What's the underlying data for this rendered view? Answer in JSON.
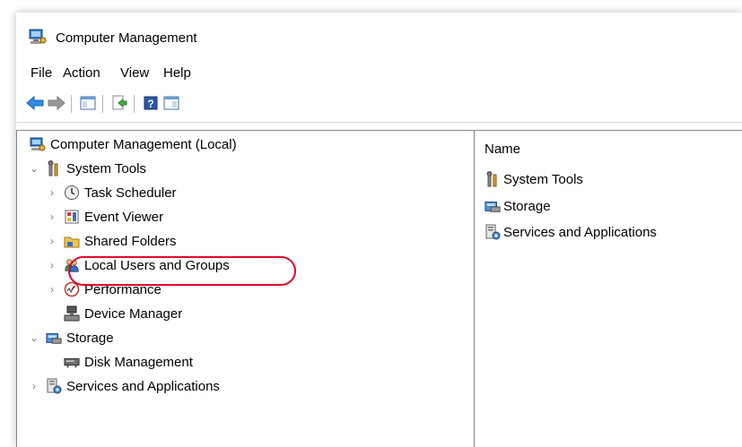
{
  "window": {
    "title": "Computer Management"
  },
  "menu": [
    "File",
    "Action",
    "View",
    "Help"
  ],
  "toolbar": [
    {
      "icon": "back-arrow-icon"
    },
    {
      "icon": "forward-arrow-icon"
    },
    {
      "icon": "show-hide-console-tree-icon"
    },
    {
      "icon": "export-list-icon"
    },
    {
      "icon": "help-icon"
    },
    {
      "icon": "show-hide-action-pane-icon"
    }
  ],
  "tree": {
    "root": "Computer Management (Local)",
    "items": [
      {
        "label": "System Tools",
        "icon": "tools-icon",
        "expanded": true
      },
      {
        "label": "Task Scheduler",
        "icon": "clock-icon"
      },
      {
        "label": "Event Viewer",
        "icon": "event-viewer-icon"
      },
      {
        "label": "Shared Folders",
        "icon": "shared-folder-icon"
      },
      {
        "label": "Local Users and Groups",
        "icon": "users-icon",
        "highlighted": true
      },
      {
        "label": "Performance",
        "icon": "performance-icon"
      },
      {
        "label": "Device Manager",
        "icon": "device-manager-icon"
      },
      {
        "label": "Storage",
        "icon": "storage-icon",
        "expanded": true
      },
      {
        "label": "Disk Management",
        "icon": "disk-icon"
      },
      {
        "label": "Services and Applications",
        "icon": "services-icon"
      }
    ]
  },
  "list": {
    "column_header": "Name",
    "items": [
      {
        "label": "System Tools",
        "icon": "tools-icon"
      },
      {
        "label": "Storage",
        "icon": "storage-icon"
      },
      {
        "label": "Services and Applications",
        "icon": "services-icon"
      }
    ]
  },
  "colors": {
    "highlight_ring": "#e0002a",
    "pane_border": "#828790"
  }
}
